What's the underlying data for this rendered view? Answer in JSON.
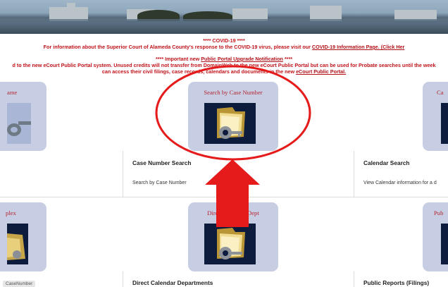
{
  "notices": {
    "covid_title": "**** COVID-19 ****",
    "covid_text": "For information about the Superior Court of Alameda County's response to the COVID-19 virus, please visit our",
    "covid_link": "COVID-19 Information Page. (Click Her",
    "portal_title_pre": "**** Important new",
    "portal_title_link": "Public Portal Upgrade Notification",
    "portal_title_post": "****",
    "portal_line1": "d to the new eCourt Public Portal system. Unused credits will not transfer from DomainWeb to the new eCourt Public Portal but can be used for Probate searches until the week",
    "portal_line2_pre": "can access their civil filings, case records, calendars and documents in the new",
    "portal_line2_link": "eCourt Public Portal."
  },
  "cards": {
    "left_top_title": "ame",
    "center_top_title": "Search by Case Number",
    "right_top_title": "Ca",
    "left_bottom_title": "plex",
    "center_bottom_title": "Direct Calendar Dept",
    "right_bottom_title": "Pub"
  },
  "tiles": {
    "case_number_search": {
      "title": "Case Number Search",
      "desc": "Search by Case Number"
    },
    "calendar_search": {
      "title": "Calendar Search",
      "desc": "View Calendar information for a d"
    },
    "direct_calendar": {
      "title": "Direct Calendar Departments"
    },
    "public_reports": {
      "title": "Public Reports (Filings)"
    }
  },
  "left_pill": "CaseNumber",
  "icons": {
    "folder_key": "folder-with-key-icon",
    "annotation_arrow": "red-up-arrow",
    "annotation_circle": "red-ellipse-highlight"
  },
  "colors": {
    "notice_red": "#c0141b",
    "card_bg": "#c7cde3",
    "card_title": "#b4252f",
    "arrow_red": "#e51a1a"
  }
}
